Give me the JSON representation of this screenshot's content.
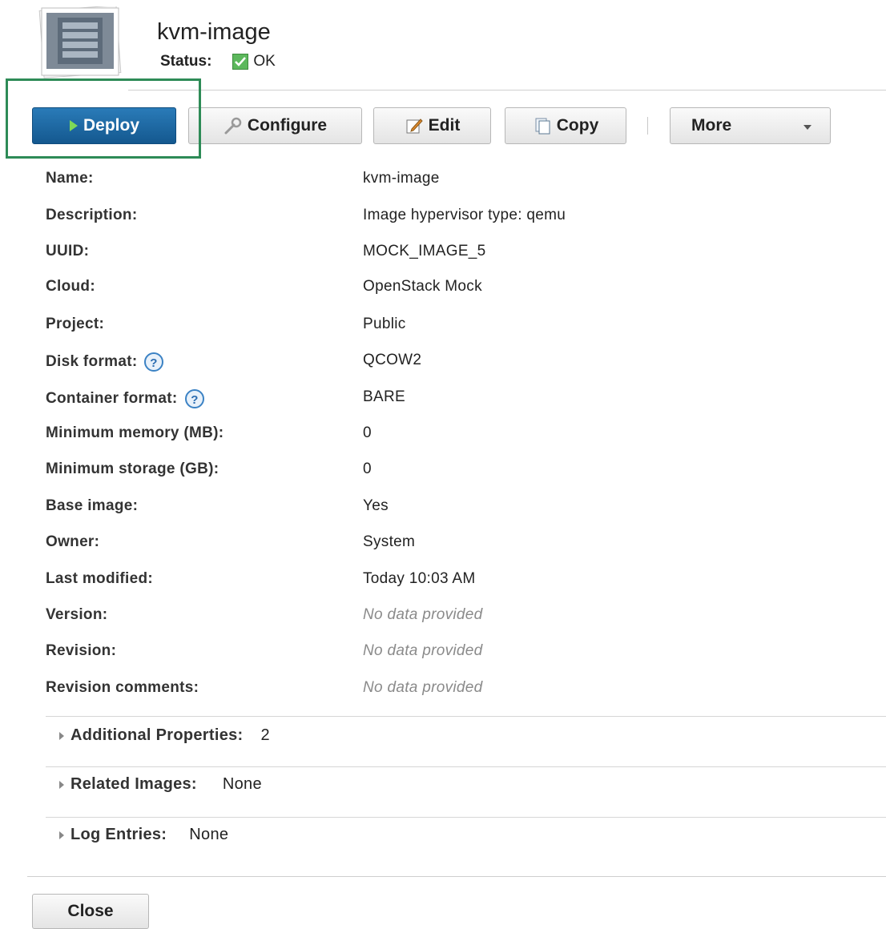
{
  "header": {
    "title": "kvm-image",
    "status_label": "Status:",
    "status_value": "OK",
    "thumbnail_icon": "server-image-icon",
    "status_icon": "check-icon"
  },
  "toolbar": {
    "deploy_label": "Deploy",
    "configure_label": "Configure",
    "edit_label": "Edit",
    "copy_label": "Copy",
    "more_label": "More"
  },
  "properties": [
    {
      "label": "Name:",
      "value": "kvm-image"
    },
    {
      "label": "Description:",
      "value": "Image hypervisor type: qemu"
    },
    {
      "label": "UUID:",
      "value": "MOCK_IMAGE_5"
    },
    {
      "label": "Cloud:",
      "value": "OpenStack Mock"
    },
    {
      "label": "Project:",
      "value": "Public"
    },
    {
      "label": "Disk format:",
      "value": "QCOW2"
    },
    {
      "label": "Container format:",
      "value": "BARE"
    },
    {
      "label": "Minimum memory (MB):",
      "value": "0"
    },
    {
      "label": "Minimum storage (GB):",
      "value": "0"
    },
    {
      "label": "Base image:",
      "value": "Yes"
    },
    {
      "label": "Owner:",
      "value": "System"
    },
    {
      "label": "Last modified:",
      "value": "Today 10:03 AM"
    },
    {
      "label": "Version:",
      "value": "No data provided"
    },
    {
      "label": "Revision:",
      "value": "No data provided"
    },
    {
      "label": "Revision comments:",
      "value": "No data provided"
    }
  ],
  "sections": [
    {
      "label": "Additional Properties:",
      "value": "2"
    },
    {
      "label": "Related Images:",
      "value": "None"
    },
    {
      "label": "Log Entries:",
      "value": "None"
    }
  ],
  "footer": {
    "close_label": "Close"
  },
  "colors": {
    "deploy_button": "#1f6aa5",
    "highlight_box": "#2e8b57",
    "ok_status": "#4caf50",
    "help_icon": "#3b82c4"
  }
}
